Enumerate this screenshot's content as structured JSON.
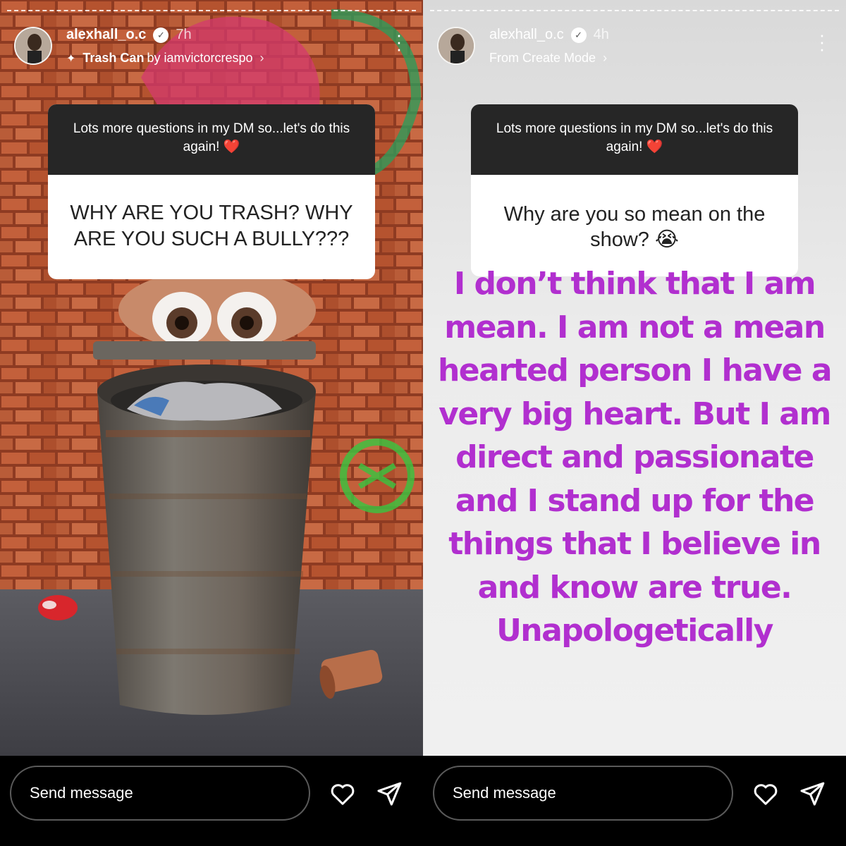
{
  "left_story": {
    "username": "alexhall_o.c",
    "time": "7h",
    "effect_name": "Trash Can",
    "effect_by": "by iamvictorcrespo",
    "question_prompt": "Lots more questions in my DM so...let's do this again! ❤️",
    "question_text": "WHY ARE YOU TRASH? WHY ARE YOU SUCH A BULLY???",
    "message_placeholder": "Send message"
  },
  "right_story": {
    "username": "alexhall_o.c",
    "time": "4h",
    "source": "From Create Mode",
    "question_prompt": "Lots more questions in my DM so...let's do this again! ❤️",
    "question_text": "Why are you so mean on the show? 😭",
    "answer_text": "I don’t think that I am mean. I am not a mean hearted person I have a very big heart. But I am direct and passionate and I stand up for the things that I believe in and know are true. Unapologetically",
    "message_placeholder": "Send message"
  },
  "icons": {
    "like": "heart-icon",
    "share": "send-icon",
    "more": "more-options-icon",
    "verified": "verified-badge-icon",
    "effect": "sparkle-icon"
  },
  "colors": {
    "answer_text": "#b12fcf",
    "question_header_bg": "#262626",
    "bottom_bar_bg": "#000000"
  }
}
